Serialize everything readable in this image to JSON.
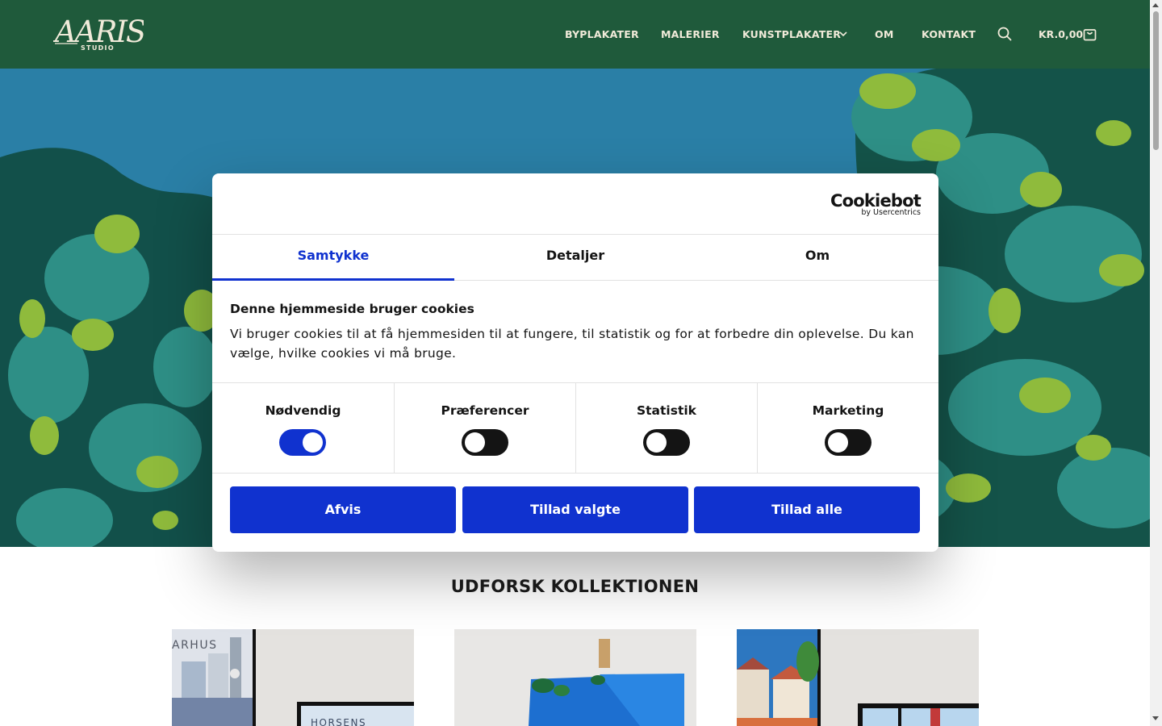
{
  "header": {
    "logo_text": "AARIS",
    "logo_subtext": "STUDIO",
    "nav": [
      "BYPLAKATER",
      "MALERIER",
      "KUNSTPLAKATER",
      "OM",
      "KONTAKT"
    ],
    "cart_total": "KR.0,00",
    "colors": {
      "background": "#1f5a3b",
      "text": "#f0ead9"
    }
  },
  "cookie_dialog": {
    "brand": "Cookiebot",
    "brand_sub": "by Usercentrics",
    "tabs": [
      {
        "label": "Samtykke",
        "active": true
      },
      {
        "label": "Detaljer",
        "active": false
      },
      {
        "label": "Om",
        "active": false
      }
    ],
    "heading": "Denne hjemmeside bruger cookies",
    "text": "Vi bruger cookies til at få hjemmesiden til at fungere, til statistik og for at forbedre din oplevelse. Du kan vælge, hvilke cookies vi må bruge.",
    "categories": [
      {
        "label": "Nødvendig",
        "enabled": true
      },
      {
        "label": "Præferencer",
        "enabled": false
      },
      {
        "label": "Statistik",
        "enabled": false
      },
      {
        "label": "Marketing",
        "enabled": false
      }
    ],
    "buttons": {
      "reject": "Afvis",
      "allow_selected": "Tillad valgte",
      "allow_all": "Tillad alle"
    },
    "colors": {
      "accent": "#1032cf"
    }
  },
  "collection": {
    "title": "UDFORSK KOLLEKTIONEN",
    "cards": [
      {
        "poster_city": "ARHUS",
        "second_poster": "HORSENS"
      },
      {
        "poster_city": ""
      },
      {
        "poster_city": ""
      }
    ]
  }
}
